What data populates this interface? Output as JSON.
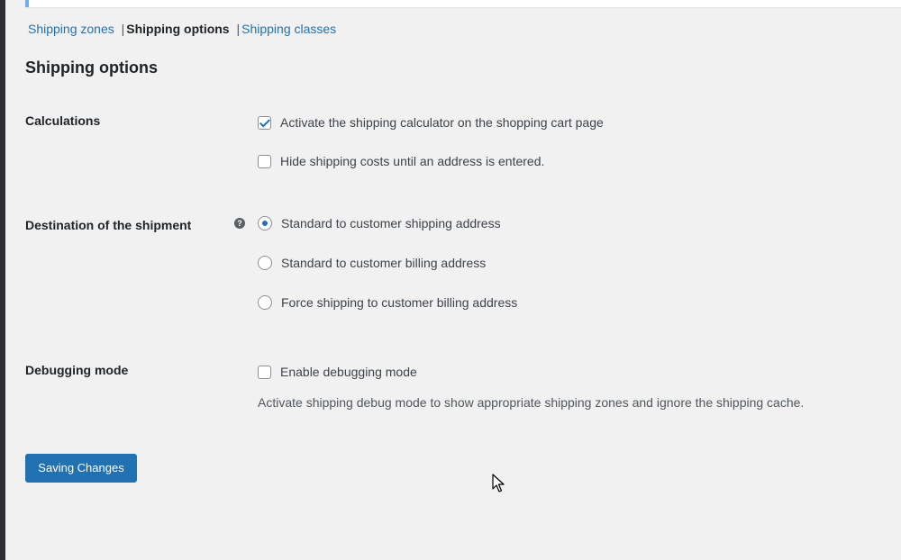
{
  "nav": {
    "items": [
      {
        "label": "Shipping zones",
        "current": false
      },
      {
        "label": "Shipping options",
        "current": true
      },
      {
        "label": "Shipping classes",
        "current": false
      }
    ],
    "separator": "|"
  },
  "page": {
    "title": "Shipping options"
  },
  "calculations": {
    "label": "Calculations",
    "options": [
      {
        "label": "Activate the shipping calculator on the shopping cart page",
        "checked": true
      },
      {
        "label": "Hide shipping costs until an address is entered.",
        "checked": false
      }
    ]
  },
  "destination": {
    "label": "Destination of the shipment",
    "help_icon": "question-circle-icon",
    "help_glyph": "?",
    "options": [
      {
        "label": "Standard to customer shipping address",
        "selected": true
      },
      {
        "label": "Standard to customer billing address",
        "selected": false
      },
      {
        "label": "Force shipping to customer billing address",
        "selected": false
      }
    ]
  },
  "debugging": {
    "label": "Debugging mode",
    "option": {
      "label": "Enable debugging mode",
      "checked": false
    },
    "description": "Activate shipping debug mode to show appropriate shipping zones and ignore the shipping cache."
  },
  "save_button": {
    "label": "Saving Changes"
  },
  "colors": {
    "accent": "#2271b1",
    "background": "#f1f1f1",
    "heading": "#1d2327"
  }
}
